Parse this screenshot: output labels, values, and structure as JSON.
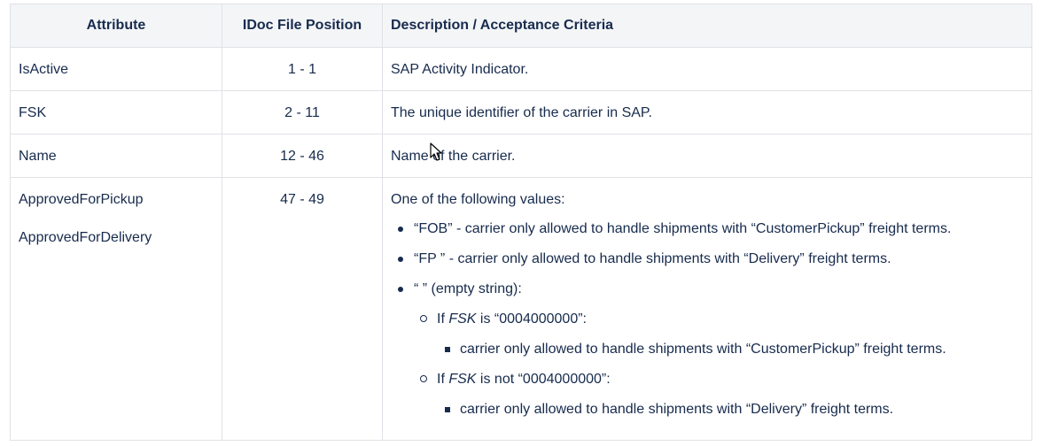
{
  "table": {
    "headers": [
      "Attribute",
      "IDoc File Position",
      "Description / Acceptance Criteria"
    ],
    "rows": [
      {
        "attribute": "IsActive",
        "position": "1 - 1",
        "description": "SAP Activity Indicator."
      },
      {
        "attribute": "FSK",
        "position": "2 - 11",
        "description": "The unique identifier of the carrier in SAP."
      },
      {
        "attribute": "Name",
        "position": "12 - 46",
        "description": "Name of the carrier."
      },
      {
        "attributes": [
          "ApprovedForPickup",
          "ApprovedForDelivery"
        ],
        "position": "47 - 49",
        "description_intro": "One of the following values:",
        "bullets": [
          "“FOB” - carrier only allowed to handle shipments with “CustomerPickup” freight terms.",
          "“FP ” - carrier only allowed to handle shipments with “Delivery” freight terms.",
          "“ ” (empty string):"
        ],
        "sub_bullets": [
          {
            "prefix": "If ",
            "field": "FSK",
            "suffix": " is “0004000000”:",
            "detail": "carrier only allowed to handle shipments with “CustomerPickup” freight terms."
          },
          {
            "prefix": "If ",
            "field": "FSK",
            "suffix": " is not “0004000000”:",
            "detail": "carrier only allowed to handle shipments with “Delivery” freight terms."
          }
        ]
      }
    ]
  },
  "icons": {
    "cursor": "mouse-pointer-icon"
  }
}
